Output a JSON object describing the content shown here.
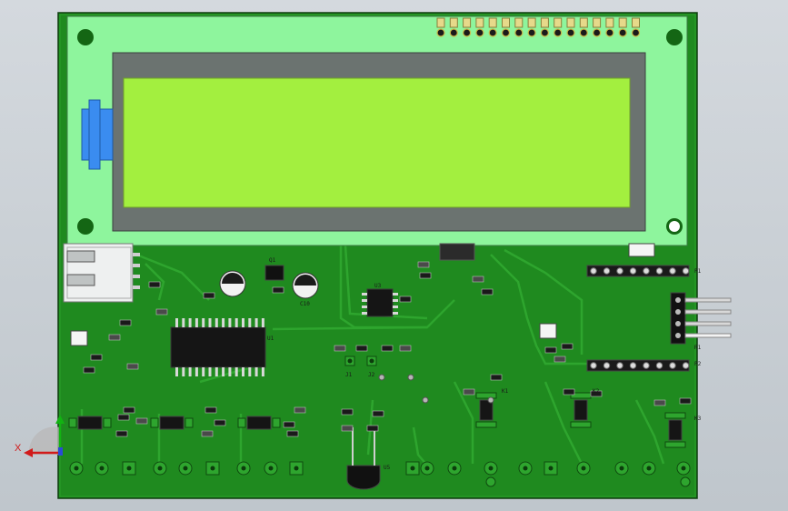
{
  "viewport": {
    "background": "#c9d0d6"
  },
  "colors": {
    "pcb": "#1f8a1f",
    "pcb_dark": "#146614",
    "trace": "#2ea52e",
    "lcd_frame": "#8ef59d",
    "lcd_bezel": "#6b7370",
    "lcd_screen": "#a3ef3f",
    "connector_blue": "#3a8cf0",
    "usb_white": "#eef0f0"
  },
  "components": {
    "u1": "U1",
    "u3": "U3",
    "u5": "U5",
    "j1": "J1",
    "j2": "J2",
    "q1": "Q1",
    "r1": "R1",
    "c10": "C10",
    "p1": "P1",
    "p2": "P2",
    "p3": "P3",
    "k1": "K1",
    "k2": "K2",
    "k3": "K3",
    "j4": "J4",
    "j5": "J5"
  },
  "axes": {
    "x_label": "X",
    "x_color": "#d11a1a",
    "y_color": "#12b312"
  }
}
